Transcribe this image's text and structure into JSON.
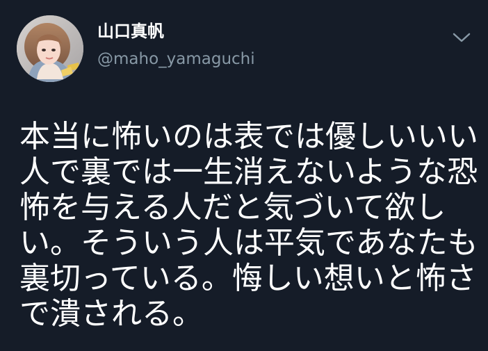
{
  "author": {
    "display_name": "山口真帆",
    "handle": "@maho_yamaguchi",
    "avatar_icon": "profile-photo"
  },
  "menu": {
    "icon": "chevron-down-icon"
  },
  "tweet": {
    "lines": [
      "本当に怖いのは表では優しいいい",
      "人で裏では一生消えないような恐",
      "怖を与える人だと気づいて欲し",
      "い。そういう人は平気であなたも",
      "裏切っている。悔しい想いと怖さ",
      "で潰される。"
    ]
  },
  "colors": {
    "background": "#151c28",
    "text": "#ffffff",
    "secondary_text": "#8899a6"
  }
}
